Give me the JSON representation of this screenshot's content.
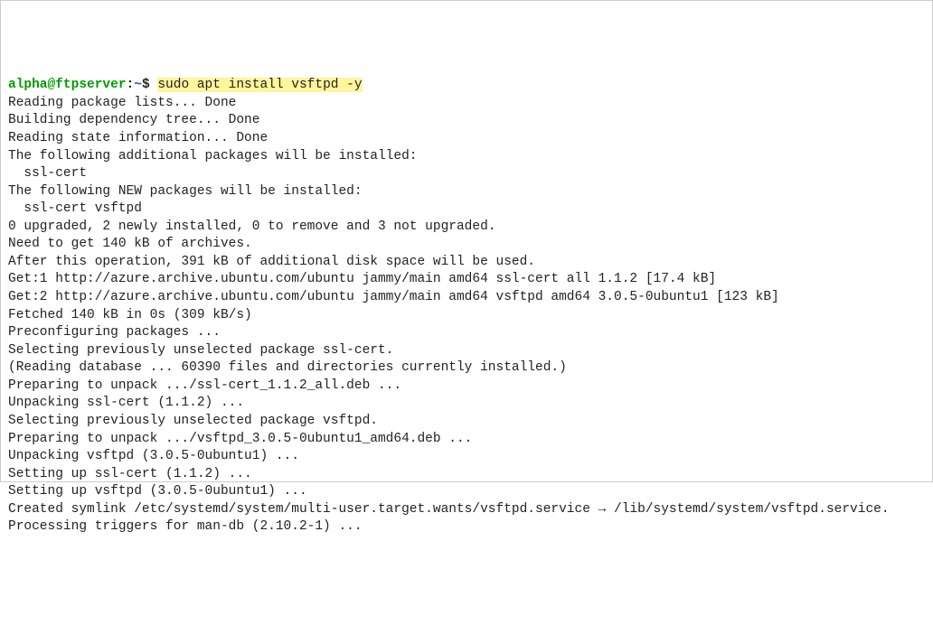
{
  "prompt": {
    "user_host": "alpha@ftpserver",
    "separator": ":",
    "path": "~",
    "dollar": "$",
    "command": "sudo apt install vsftpd -y"
  },
  "lines": [
    "Reading package lists... Done",
    "Building dependency tree... Done",
    "Reading state information... Done",
    "The following additional packages will be installed:",
    "  ssl-cert",
    "The following NEW packages will be installed:",
    "  ssl-cert vsftpd",
    "0 upgraded, 2 newly installed, 0 to remove and 3 not upgraded.",
    "Need to get 140 kB of archives.",
    "After this operation, 391 kB of additional disk space will be used.",
    "Get:1 http://azure.archive.ubuntu.com/ubuntu jammy/main amd64 ssl-cert all 1.1.2 [17.4 kB]",
    "Get:2 http://azure.archive.ubuntu.com/ubuntu jammy/main amd64 vsftpd amd64 3.0.5-0ubuntu1 [123 kB]",
    "Fetched 140 kB in 0s (309 kB/s)",
    "Preconfiguring packages ...",
    "Selecting previously unselected package ssl-cert.",
    "(Reading database ... 60390 files and directories currently installed.)",
    "Preparing to unpack .../ssl-cert_1.1.2_all.deb ...",
    "Unpacking ssl-cert (1.1.2) ...",
    "Selecting previously unselected package vsftpd.",
    "Preparing to unpack .../vsftpd_3.0.5-0ubuntu1_amd64.deb ...",
    "Unpacking vsftpd (3.0.5-0ubuntu1) ...",
    "Setting up ssl-cert (1.1.2) ...",
    "Setting up vsftpd (3.0.5-0ubuntu1) ...",
    "Created symlink /etc/systemd/system/multi-user.target.wants/vsftpd.service → /lib/systemd/system/vsftpd.service.",
    "Processing triggers for man-db (2.10.2-1) ..."
  ]
}
